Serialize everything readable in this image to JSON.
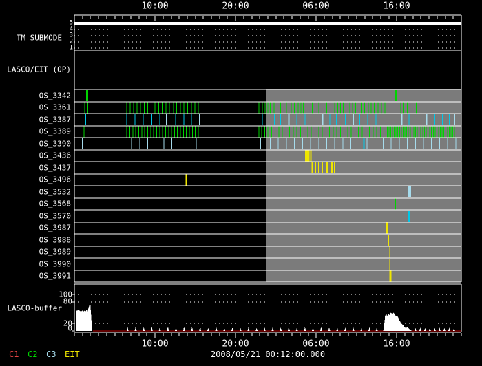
{
  "colors": {
    "background": "#000000",
    "frame": "#ffffff",
    "shade": "#7b7b7b",
    "green": "#00d400",
    "cyan": "#00c8e8",
    "paleCyan": "#a6dbec",
    "yellow": "#efe600",
    "bufferFill": "#ffffff",
    "bufferZeroLine": "#c00000"
  },
  "header": {
    "top_tick_labels": [
      "10:00",
      "20:00",
      "06:00",
      "16:00"
    ]
  },
  "bottom": {
    "tick_labels": [
      "10:00",
      "20:00",
      "06:00",
      "16:00"
    ],
    "timestamp": "2008/05/21 00:12:00.000"
  },
  "legend": [
    {
      "label": "C1",
      "color": "#e84444"
    },
    {
      "label": "C2",
      "color": "#00d400"
    },
    {
      "label": "C3",
      "color": "#a6dbec"
    },
    {
      "label": "EIT",
      "color": "#efe600"
    }
  ],
  "tm_scale": [
    "5",
    "4",
    "3",
    "2",
    "1"
  ],
  "buffer_scale": [
    "100",
    "80",
    "20",
    "0"
  ],
  "chart_data": [
    {
      "type": "timeline",
      "x_axis": {
        "hours_span": 48,
        "minor_tick_every_hours": 1,
        "major_tick_hours": [
          10,
          20,
          30,
          40
        ],
        "major_tick_labels": [
          "10:00",
          "20:00",
          "06:00",
          "16:00"
        ]
      },
      "shaded_region": {
        "from_hour": 23.8,
        "to_hour": 47.9,
        "color": "#7b7b7b"
      },
      "tm_submode": {
        "label": "TM SUBMODE",
        "scale": [
          5,
          4,
          3,
          2,
          1
        ],
        "value": 5,
        "from_hour": 0,
        "to_hour": 48
      },
      "lasco_eit_op": {
        "label": "LASCO/EIT (OP)",
        "events": []
      },
      "rows": [
        {
          "label": "OS_3342",
          "marks": [
            {
              "color": "green",
              "width": 3,
              "hours": [
                1.6,
                39.9
              ]
            }
          ]
        },
        {
          "label": "OS_3361",
          "marks": [
            {
              "color": "green",
              "width": 1,
              "hours": [
                1.3,
                1.65,
                6.5,
                6.93,
                7.36,
                7.79,
                8.22,
                8.65,
                9.08,
                9.51,
                10.0,
                10.45,
                10.9,
                11.35,
                11.8,
                12.28,
                12.7,
                13.15,
                13.6,
                14.03,
                14.5,
                14.93,
                15.38,
                22.9,
                23.3,
                23.65,
                24.0,
                24.3,
                24.75,
                25.6,
                26.3,
                26.6,
                26.9,
                27.3,
                27.75,
                28.1,
                28.4,
                29.5,
                30.3,
                31.3,
                32.3,
                32.65,
                33.0,
                33.35,
                33.7,
                34.15,
                34.5,
                34.9,
                35.3,
                35.65,
                36.0,
                36.45,
                36.8,
                37.2,
                37.65,
                38.1,
                38.5,
                39.4,
                40.5,
                40.8,
                41.3,
                41.9,
                42.4
              ]
            }
          ]
        },
        {
          "label": "OS_3387",
          "marks": [
            {
              "color": "cyan",
              "width": 1,
              "hours": [
                1.4,
                6.5,
                7.5,
                8.55,
                9.6,
                10.6,
                12.55,
                13.6,
                14.5,
                23.3,
                24.8,
                25.6,
                27.6,
                28.6,
                31.7,
                32.5,
                33.6,
                35.4,
                36.4,
                37.4,
                38.4,
                39.4,
                41.5,
                42.5,
                44.7,
                46.5
              ]
            },
            {
              "color": "paleCyan",
              "width": 2,
              "hours": [
                11.45,
                15.55,
                26.6,
                30.8,
                34.6,
                40.6,
                43.7,
                47.15
              ]
            },
            {
              "color": "cyan",
              "width": 2,
              "hours": [
                45.7
              ]
            }
          ]
        },
        {
          "label": "OS_3389",
          "marks": [
            {
              "color": "green",
              "width": 1,
              "hours": [
                1.2,
                22.9,
                23.25,
                23.6
              ],
              "runs": [
                [
                  6.5,
                  15.4,
                  0.37
                ],
                [
                  24.0,
                  38.42,
                  0.45
                ],
                [
                  38.8,
                  47.3,
                  0.22
                ]
              ]
            }
          ]
        },
        {
          "label": "OS_3390",
          "marks": [
            {
              "color": "paleCyan",
              "width": 1,
              "hours": [
                1.0,
                7.1,
                8.1,
                9.1,
                10.1,
                11.1,
                12.1,
                13.1,
                15.1,
                23.1
              ],
              "runs": [
                [
                  24.3,
                  47.3,
                  1.0
                ]
              ]
            },
            {
              "color": "cyan",
              "width": 2,
              "hours": [
                35.9
              ]
            }
          ]
        },
        {
          "label": "OS_3436",
          "marks": [
            {
              "color": "yellow",
              "width": 2,
              "hours": [
                28.7,
                28.85,
                29.1,
                29.35
              ]
            }
          ]
        },
        {
          "label": "OS_3437",
          "marks": [
            {
              "color": "yellow",
              "width": 2,
              "hours": [
                29.5,
                29.9,
                30.3,
                30.75,
                31.35,
                31.95,
                32.3
              ]
            }
          ]
        },
        {
          "label": "OS_3496",
          "marks": [
            {
              "color": "yellow",
              "width": 2,
              "hours": [
                13.9
              ]
            }
          ]
        },
        {
          "label": "OS_3532",
          "marks": [
            {
              "color": "paleCyan",
              "width": 4,
              "hours": [
                41.6
              ]
            }
          ]
        },
        {
          "label": "OS_3568",
          "marks": [
            {
              "color": "green",
              "width": 2,
              "hours": [
                39.8
              ]
            }
          ]
        },
        {
          "label": "OS_3570",
          "marks": [
            {
              "color": "cyan",
              "width": 2,
              "hours": [
                41.5
              ]
            }
          ]
        },
        {
          "label": "OS_3987",
          "marks": [
            {
              "color": "yellow",
              "width": 3,
              "hours": [
                38.8
              ]
            }
          ]
        },
        {
          "label": "OS_3988",
          "marks": [
            {
              "color": "yellow",
              "width": 1,
              "hours": [
                39.0
              ]
            }
          ]
        },
        {
          "label": "OS_3989",
          "marks": [
            {
              "color": "yellow",
              "width": 1,
              "hours": [
                39.1
              ]
            }
          ]
        },
        {
          "label": "OS_3990",
          "marks": [
            {
              "color": "yellow",
              "width": 1,
              "hours": [
                39.1
              ]
            }
          ]
        },
        {
          "label": "OS_3991",
          "marks": [
            {
              "color": "yellow",
              "width": 3,
              "hours": [
                39.2
              ]
            }
          ]
        }
      ]
    },
    {
      "type": "area",
      "name": "LASCO-buffer",
      "ylabel_ticks": [
        100,
        80,
        20,
        0
      ],
      "ylim": [
        0,
        115
      ],
      "grid_dotted_values": [
        100,
        80,
        20
      ],
      "fill": "#ffffff",
      "zero_line": {
        "value": 0,
        "from_hour": 2.3,
        "to_hour": 48,
        "color": "#c00000"
      },
      "segments": [
        [
          [
            0.15,
            0
          ],
          [
            0.2,
            55
          ],
          [
            0.55,
            57
          ],
          [
            0.8,
            53
          ],
          [
            1.0,
            56
          ],
          [
            1.1,
            51
          ],
          [
            1.2,
            56
          ],
          [
            1.35,
            53
          ],
          [
            1.5,
            57
          ],
          [
            1.65,
            54
          ],
          [
            1.75,
            63
          ],
          [
            1.82,
            70
          ],
          [
            1.9,
            64
          ],
          [
            1.98,
            72
          ],
          [
            2.05,
            52
          ],
          [
            2.12,
            28
          ],
          [
            2.2,
            0
          ]
        ],
        [
          [
            38.3,
            0
          ],
          [
            38.45,
            20
          ],
          [
            38.55,
            42
          ],
          [
            38.7,
            46
          ],
          [
            38.8,
            40
          ],
          [
            38.95,
            48
          ],
          [
            39.1,
            43
          ],
          [
            39.25,
            50
          ],
          [
            39.45,
            47
          ],
          [
            39.6,
            50
          ],
          [
            39.75,
            44
          ],
          [
            39.9,
            40
          ],
          [
            40.05,
            42
          ],
          [
            40.2,
            35
          ],
          [
            40.35,
            28
          ],
          [
            40.5,
            22
          ],
          [
            40.7,
            18
          ],
          [
            40.9,
            12
          ],
          [
            41.1,
            8
          ],
          [
            41.3,
            10
          ],
          [
            41.5,
            6
          ],
          [
            41.7,
            2
          ],
          [
            41.9,
            0
          ]
        ]
      ],
      "spikes": [
        [
          6.6,
          10
        ],
        [
          7.6,
          12
        ],
        [
          8.6,
          10
        ],
        [
          9.6,
          11
        ],
        [
          10.6,
          10
        ],
        [
          11.6,
          12
        ],
        [
          12.6,
          10
        ],
        [
          13.6,
          11
        ],
        [
          14.6,
          10
        ],
        [
          15.6,
          12
        ],
        [
          16.6,
          8
        ],
        [
          17.6,
          10
        ],
        [
          18.6,
          8
        ],
        [
          19.6,
          9
        ],
        [
          20.6,
          8
        ],
        [
          21.6,
          10
        ],
        [
          22.6,
          8
        ],
        [
          23.6,
          9
        ],
        [
          24.6,
          10
        ],
        [
          25.6,
          9
        ],
        [
          26.6,
          11
        ],
        [
          27.6,
          9
        ],
        [
          28.6,
          10
        ],
        [
          29.6,
          9
        ],
        [
          30.6,
          11
        ],
        [
          31.6,
          9
        ],
        [
          32.6,
          10
        ],
        [
          33.6,
          9
        ],
        [
          34.6,
          10
        ],
        [
          35.6,
          9
        ],
        [
          36.6,
          10
        ],
        [
          37.5,
          8
        ],
        [
          42.3,
          8
        ],
        [
          42.9,
          9
        ],
        [
          43.5,
          8
        ],
        [
          44.1,
          9
        ],
        [
          44.7,
          8
        ],
        [
          45.3,
          9
        ],
        [
          45.9,
          8
        ],
        [
          46.5,
          9
        ],
        [
          47.1,
          8
        ]
      ],
      "spike_half_width_hours": 0.13
    }
  ]
}
